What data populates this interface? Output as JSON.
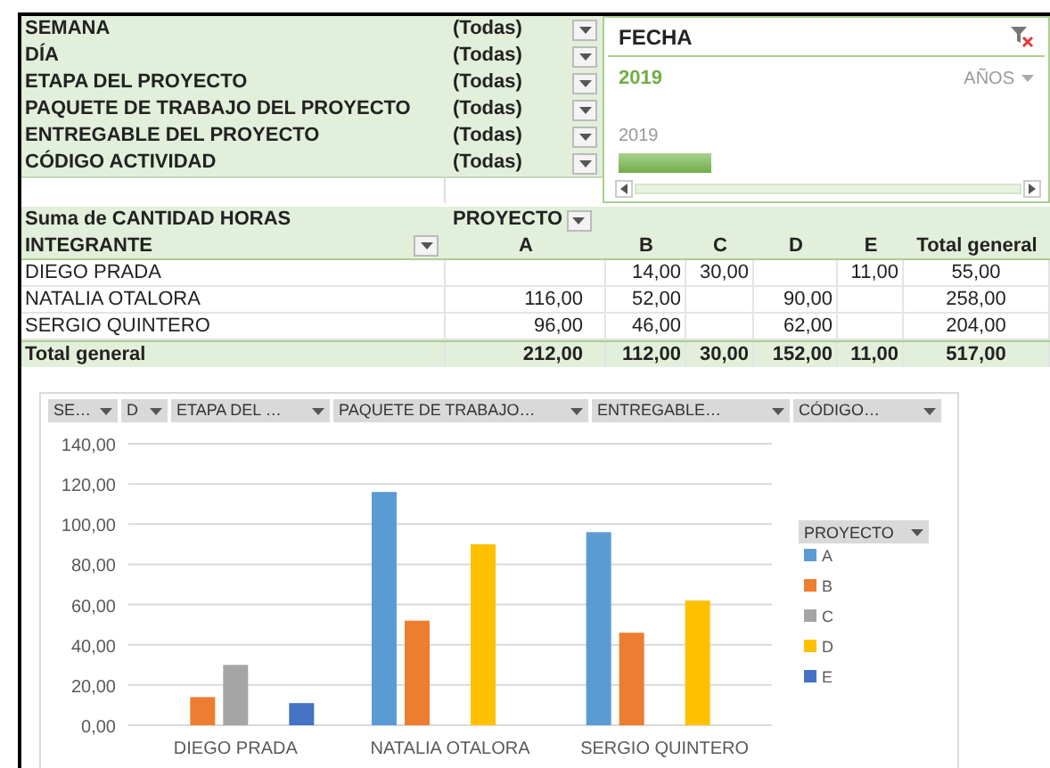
{
  "filters": [
    {
      "label": "SEMANA",
      "value": "(Todas)"
    },
    {
      "label": "DÍA",
      "value": "(Todas)"
    },
    {
      "label": "ETAPA DEL PROYECTO",
      "value": "(Todas)"
    },
    {
      "label": "PAQUETE DE TRABAJO DEL PROYECTO",
      "value": "(Todas)"
    },
    {
      "label": "ENTREGABLE DEL PROYECTO",
      "value": "(Todas)"
    },
    {
      "label": "CÓDIGO ACTIVIDAD",
      "value": "(Todas)"
    }
  ],
  "slicer": {
    "title": "FECHA",
    "selection": "2019",
    "time_level": "AÑOS",
    "timeline_year": "2019"
  },
  "pivot": {
    "corner": "Suma de CANTIDAD HORAS",
    "column_field": "PROYECTO",
    "row_field": "INTEGRANTE",
    "columns": [
      "A",
      "B",
      "C",
      "D",
      "E",
      "Total general"
    ],
    "rows": [
      {
        "label": "DIEGO PRADA",
        "values": {
          "b": "14,00",
          "c": "30,00",
          "e": "11,00",
          "total": "55,00"
        }
      },
      {
        "label": "NATALIA OTALORA",
        "values": {
          "a": "116,00",
          "b": "52,00",
          "d": "90,00",
          "total": "258,00"
        }
      },
      {
        "label": "SERGIO QUINTERO",
        "values": {
          "a": "96,00",
          "b": "46,00",
          "d": "62,00",
          "total": "204,00"
        }
      }
    ],
    "total": {
      "label": "Total general",
      "values": {
        "a": "212,00",
        "b": "112,00",
        "c": "30,00",
        "d": "152,00",
        "e": "11,00",
        "total": "517,00"
      }
    }
  },
  "chart": {
    "field_buttons": [
      "SE…",
      "D",
      "ETAPA DEL …",
      "PAQUETE DE TRABAJO…",
      "ENTREGABLE…",
      "CÓDIGO…"
    ],
    "legend_title": "PROYECTO",
    "chart_data": {
      "type": "bar",
      "categories": [
        "DIEGO PRADA",
        "NATALIA OTALORA",
        "SERGIO QUINTERO"
      ],
      "series": [
        {
          "name": "A",
          "color": "#5b9bd5",
          "values": [
            null,
            116,
            96
          ]
        },
        {
          "name": "B",
          "color": "#ed7d31",
          "values": [
            14,
            52,
            46
          ]
        },
        {
          "name": "C",
          "color": "#a5a5a5",
          "values": [
            30,
            null,
            null
          ]
        },
        {
          "name": "D",
          "color": "#ffc000",
          "values": [
            null,
            90,
            62
          ]
        },
        {
          "name": "E",
          "color": "#4472c4",
          "values": [
            11,
            null,
            null
          ]
        }
      ],
      "ylim": [
        0,
        140
      ],
      "grid": true,
      "legend": true,
      "yticks": [
        {
          "value": 0,
          "label": "0,00"
        },
        {
          "value": 20,
          "label": "20,00"
        },
        {
          "value": 40,
          "label": "40,00"
        },
        {
          "value": 60,
          "label": "60,00"
        },
        {
          "value": 80,
          "label": "80,00"
        },
        {
          "value": 100,
          "label": "100,00"
        },
        {
          "value": 120,
          "label": "120,00"
        },
        {
          "value": 140,
          "label": "140,00"
        }
      ]
    }
  }
}
